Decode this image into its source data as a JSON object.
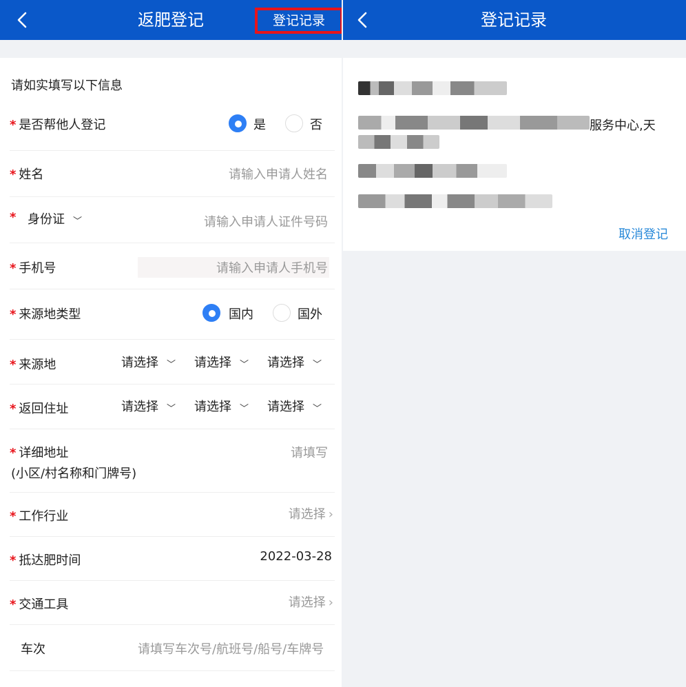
{
  "left_panel": {
    "header": {
      "title": "返肥登记",
      "record_button": "登记记录"
    },
    "intro": "请如实填写以下信息",
    "help_other": {
      "label": "是否帮他人登记",
      "options": [
        "是",
        "否"
      ],
      "selected": "是"
    },
    "name": {
      "label": "姓名",
      "placeholder": "请输入申请人姓名"
    },
    "id_type": {
      "label": "身份证",
      "placeholder": "请输入申请人证件号码"
    },
    "phone": {
      "label": "手机号",
      "placeholder": "请输入申请人手机号"
    },
    "origin_type": {
      "label": "来源地类型",
      "options": [
        "国内",
        "国外"
      ],
      "selected": "国内"
    },
    "origin": {
      "label": "来源地",
      "selects": [
        "请选择",
        "请选择",
        "请选择"
      ]
    },
    "return_address": {
      "label": "返回住址",
      "selects": [
        "请选择",
        "请选择",
        "请选择"
      ]
    },
    "detail_address": {
      "label": "详细地址",
      "sublabel": "(小区/村名称和门牌号)",
      "placeholder": "请填写"
    },
    "industry": {
      "label": "工作行业",
      "placeholder": "请选择"
    },
    "arrival_time": {
      "label": "抵达肥时间",
      "value": "2022-03-28"
    },
    "transport": {
      "label": "交通工具",
      "placeholder": "请选择"
    },
    "trip_number": {
      "label": "车次",
      "placeholder": "请填写车次号/航班号/船号/车牌号"
    }
  },
  "right_panel": {
    "header": {
      "title": "登记记录"
    },
    "record": {
      "visible_text": "服务中心,天",
      "cancel_label": "取消登记"
    }
  },
  "colors": {
    "header_blue": "#0a58c9",
    "required_star": "#e8141b",
    "radio_active": "#2e7ff5",
    "link_blue": "#2a8ad9",
    "highlight_box": "#e8141b"
  }
}
